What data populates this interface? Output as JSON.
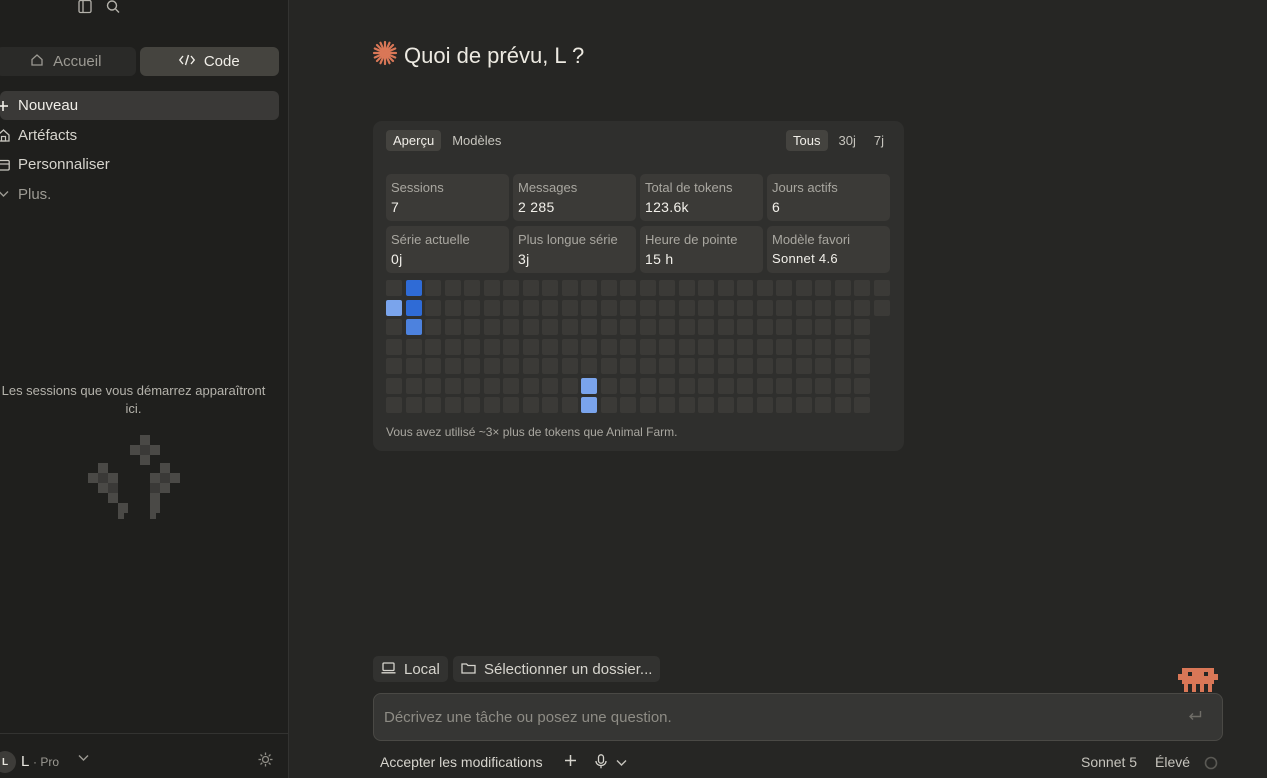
{
  "sidebar": {
    "modes": [
      {
        "label": "Accueil",
        "icon": "home-icon",
        "active": false
      },
      {
        "label": "Code",
        "icon": "code-icon",
        "active": true
      }
    ],
    "nav": [
      {
        "label": "Nouveau",
        "icon": "plus-icon",
        "active": true
      },
      {
        "label": "Artéfacts",
        "icon": "artifacts-icon"
      },
      {
        "label": "Personnaliser",
        "icon": "customize-icon"
      },
      {
        "label": "Plus.",
        "icon": "chevron-down-icon"
      }
    ],
    "empty_state": "Les sessions que vous démarrez apparaîtront ici.",
    "user": {
      "initial": "L",
      "name": "L",
      "plan": "· Pro"
    }
  },
  "main": {
    "greeting": "Quoi de prévu, L ?",
    "stats": {
      "tabs_left": [
        "Aperçu",
        "Modèles"
      ],
      "tabs_right": [
        "Tous",
        "30j",
        "7j"
      ],
      "cards": [
        {
          "label": "Sessions",
          "value": "7"
        },
        {
          "label": "Messages",
          "value": "2 285"
        },
        {
          "label": "Total de tokens",
          "value": "123.6k"
        },
        {
          "label": "Jours actifs",
          "value": "6"
        },
        {
          "label": "Série actuelle",
          "value": "0j"
        },
        {
          "label": "Plus longue série",
          "value": "3j"
        },
        {
          "label": "Heure de pointe",
          "value": "15 h"
        },
        {
          "label": "Modèle favori",
          "value": "Sonnet 4.6"
        }
      ],
      "activity": {
        "columns": 26,
        "rows": 7,
        "last_column_rows": 2,
        "active_cells": [
          {
            "col": 1,
            "row": 0,
            "level": "high"
          },
          {
            "col": 0,
            "row": 1,
            "level": "low"
          },
          {
            "col": 1,
            "row": 1,
            "level": "high"
          },
          {
            "col": 1,
            "row": 2,
            "level": "mid"
          },
          {
            "col": 10,
            "row": 5,
            "level": "low"
          },
          {
            "col": 10,
            "row": 6,
            "level": "low"
          }
        ],
        "colors": {
          "empty": "#3b3a37",
          "low": "#7aa4ec",
          "mid": "#4d82de",
          "high": "#2f6bd6"
        }
      },
      "note": "Vous avez utilisé ~3× plus de tokens que Animal Farm."
    },
    "chips": [
      {
        "label": "Local",
        "icon": "laptop-icon"
      },
      {
        "label": "Sélectionner un dossier...",
        "icon": "folder-icon"
      }
    ],
    "prompt": {
      "placeholder": "Décrivez une tâche ou posez une question."
    },
    "bottom_bar": {
      "accept": "Accepter les modifications",
      "model": "Sonnet 5",
      "effort": "Élevé"
    }
  },
  "colors": {
    "accent": "#d97757",
    "sidebar_bg": "#1f1f1d",
    "main_bg": "#262624"
  }
}
